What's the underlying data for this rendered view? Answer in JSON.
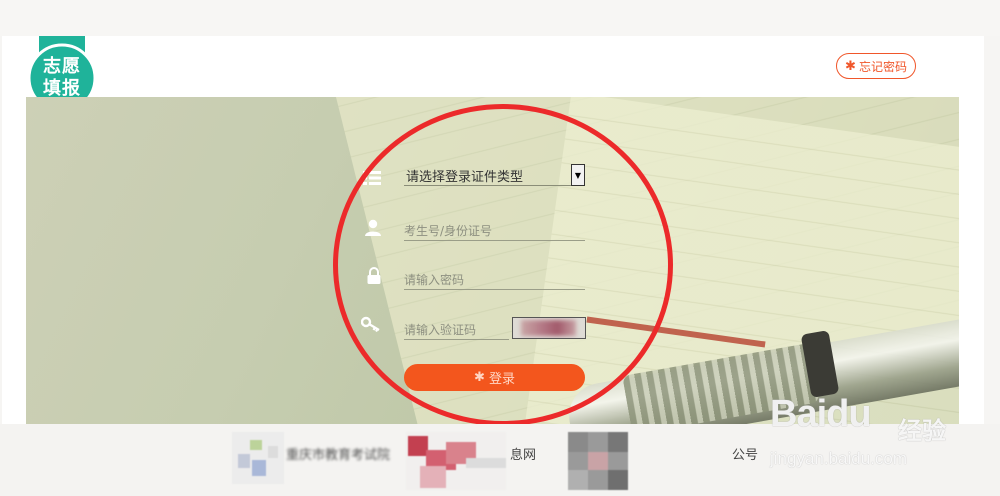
{
  "ribbon": {
    "line1": "志愿",
    "line2": "填报",
    "color": "#1fb39a"
  },
  "header": {
    "forgot_icon": "✱",
    "forgot_label": "忘记密码"
  },
  "form": {
    "id_type_select": {
      "selected": "请选择登录证件类型",
      "icon": "list-icon"
    },
    "candidate_id": {
      "placeholder": "考生号/身份证号",
      "icon": "user-icon"
    },
    "password": {
      "placeholder": "请输入密码",
      "icon": "lock-icon"
    },
    "captcha": {
      "placeholder": "请输入验证码",
      "icon": "key-icon"
    },
    "login_icon": "✱",
    "login_label": "登录"
  },
  "footer": {
    "links": [
      {
        "text": "重庆市教育考试院",
        "icon": "logo-icon"
      },
      {
        "text": "息网",
        "icon": "logo-icon"
      },
      {
        "text": "公号",
        "icon": "logo-icon"
      }
    ]
  },
  "watermark": {
    "brand": "Baidu",
    "cn": "经验",
    "url": "jingyan.baidu.com"
  },
  "colors": {
    "accent": "#f3561d",
    "annotation": "#ec2a2a",
    "ribbon": "#1fb39a"
  }
}
